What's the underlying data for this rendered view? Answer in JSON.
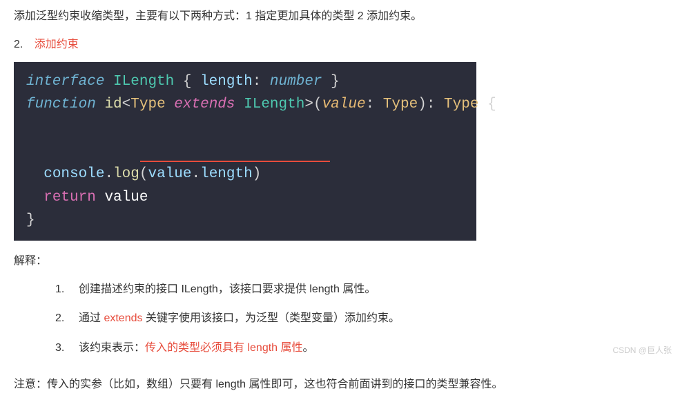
{
  "intro": "添加泛型约束收缩类型，主要有以下两种方式：1 指定更加具体的类型  2 添加约束。",
  "section": {
    "num": "2.",
    "title": "添加约束"
  },
  "code": {
    "l1": {
      "interface": "interface",
      "name": "ILength",
      "open": " { ",
      "prop": "length",
      "colon": ": ",
      "type": "number",
      "close": " }"
    },
    "l2": {
      "function": "function",
      "fn": "id",
      "lt": "<",
      "tparam": "Type",
      "extends": "extends",
      "iface": "ILength",
      "gt": ">",
      "open": "(",
      "param": "value",
      "colon": ": ",
      "ptype": "Type",
      "close": ")",
      "rcolon": ": ",
      "rtype": "Type",
      "brace": " {"
    },
    "l3": {
      "indent": "  ",
      "obj": "console",
      "dot1": ".",
      "method": "log",
      "open": "(",
      "arg": "value",
      "dot2": ".",
      "prop": "length",
      "close": ")"
    },
    "l4": {
      "indent": "  ",
      "return": "return",
      "sp": " ",
      "value": "value"
    },
    "l5": {
      "brace": "}"
    }
  },
  "explain": {
    "label": "解释：",
    "items": [
      {
        "num": "1.",
        "parts": [
          {
            "text": "创建描述约束的接口 ILength，该接口要求提供 length 属性。",
            "red": false
          }
        ]
      },
      {
        "num": "2.",
        "parts": [
          {
            "text": "通过 ",
            "red": false
          },
          {
            "text": "extends",
            "red": true
          },
          {
            "text": " 关键字使用该接口，为泛型（类型变量）添加约束。",
            "red": false
          }
        ]
      },
      {
        "num": "3.",
        "parts": [
          {
            "text": "该约束表示：",
            "red": false
          },
          {
            "text": "传入的类型必须具有 length 属性",
            "red": true
          },
          {
            "text": "。",
            "red": false
          }
        ]
      }
    ]
  },
  "note": "注意：传入的实参（比如，数组）只要有 length 属性即可，这也符合前面讲到的接口的类型兼容性。",
  "watermark": "CSDN @巨人张"
}
